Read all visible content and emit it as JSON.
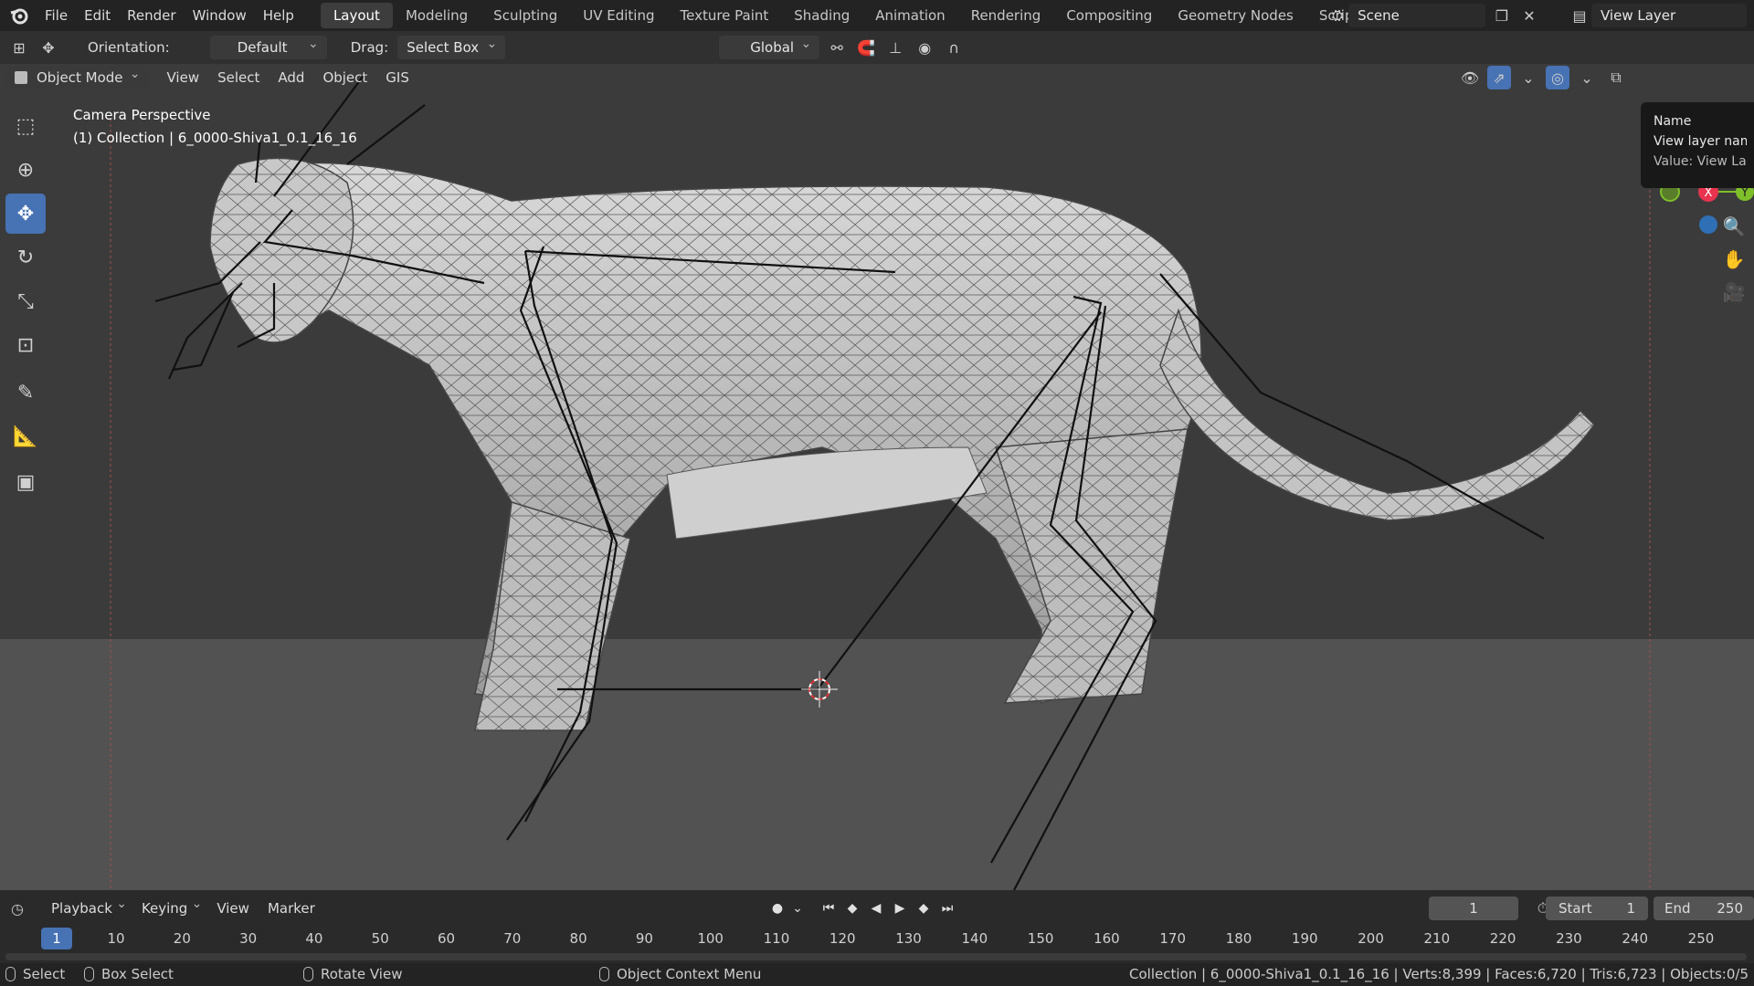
{
  "topbar": {
    "menu": [
      "File",
      "Edit",
      "Render",
      "Window",
      "Help"
    ],
    "workspaces": [
      "Layout",
      "Modeling",
      "Sculpting",
      "UV Editing",
      "Texture Paint",
      "Shading",
      "Animation",
      "Rendering",
      "Compositing",
      "Geometry Nodes",
      "Scripting"
    ],
    "active_workspace": "Layout",
    "scene": "Scene",
    "view_layer": "View Layer"
  },
  "toolheader": {
    "orientation_label": "Orientation:",
    "orientation_value": "Default",
    "drag_label": "Drag:",
    "drag_value": "Select Box",
    "transform_orientation": "Global"
  },
  "viewport": {
    "mode": "Object Mode",
    "menu": [
      "View",
      "Select",
      "Add",
      "Object",
      "GIS"
    ],
    "camera_label": "Camera Perspective",
    "collection_label": "(1) Collection | 6_0000-Shiva1_0.1_16_16",
    "tools": [
      "select-box-icon",
      "cursor-icon",
      "move-icon",
      "rotate-icon",
      "scale-icon",
      "transform-icon",
      "annotate-icon",
      "measure-icon",
      "add-cube-icon"
    ],
    "active_tool": "move-icon"
  },
  "tooltip": {
    "title": "Name",
    "line1": "View layer name",
    "line2": "Value: View Layer"
  },
  "gizmo": {
    "x_label": "X",
    "y_label": "Y",
    "x_color": "#e8344f",
    "y_color": "#7fbf2a",
    "z_color": "#2f6fb5"
  },
  "timeline": {
    "menu": [
      "Playback",
      "Keying",
      "View",
      "Marker"
    ],
    "current_frame": "1",
    "start_label": "Start",
    "start_value": "1",
    "end_label": "End",
    "end_value": "250",
    "ruler": [
      "1",
      "10",
      "20",
      "30",
      "40",
      "50",
      "60",
      "70",
      "80",
      "90",
      "100",
      "110",
      "120",
      "130",
      "140",
      "150",
      "160",
      "170",
      "180",
      "190",
      "200",
      "210",
      "220",
      "230",
      "240",
      "250"
    ]
  },
  "statusbar": {
    "select": "Select",
    "box_select": "Box Select",
    "rotate_view": "Rotate View",
    "context_menu": "Object Context Menu",
    "stats": "Collection | 6_0000-Shiva1_0.1_16_16 | Verts:8,399 | Faces:6,720 | Tris:6,723 | Objects:0/5"
  },
  "colors": {
    "accent": "#4772b3",
    "viewport_bg": "#3b3b3b",
    "floor": "#525252"
  }
}
